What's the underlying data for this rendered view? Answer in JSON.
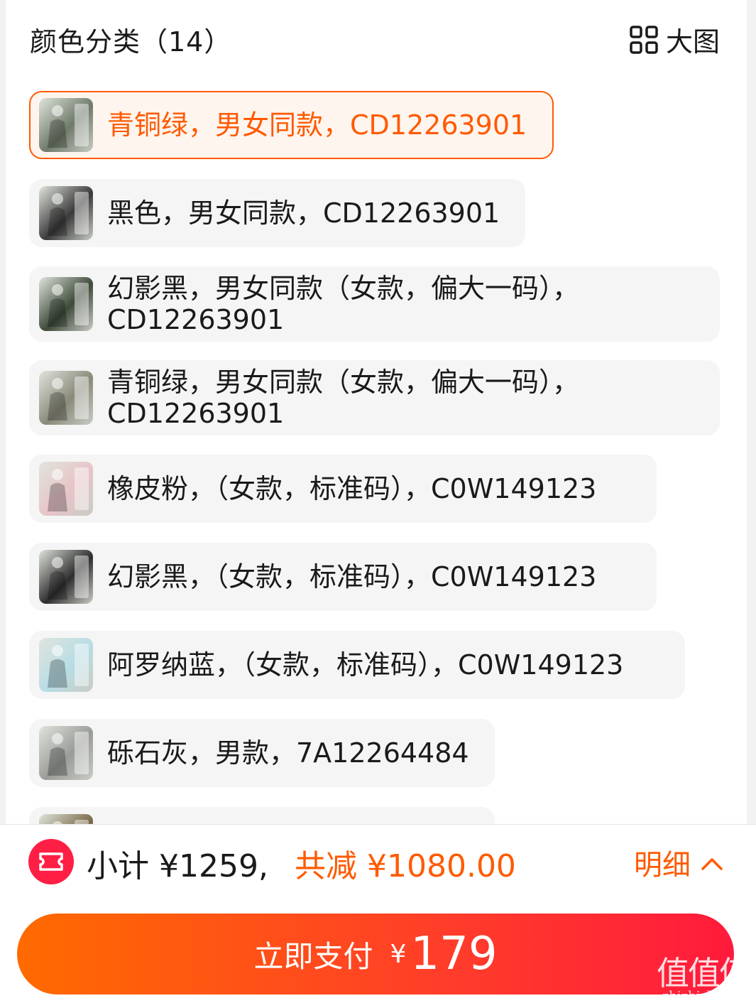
{
  "header": {
    "title": "颜色分类（14）",
    "big_image_label": "大图",
    "big_image_icon": "grid-icon"
  },
  "options": [
    {
      "label": "青铜绿，男女同款，CD12263901",
      "selected": true,
      "thumb_color": "#6f7a6a"
    },
    {
      "label": "黑色，男女同款，CD12263901",
      "selected": false,
      "thumb_color": "#3a3a3a"
    },
    {
      "label": "幻影黑，男女同款（女款，偏大一码），\nCD12263901",
      "selected": false,
      "thumb_color": "#3e4a3a"
    },
    {
      "label": "青铜绿，男女同款（女款，偏大一码），\nCD12263901",
      "selected": false,
      "thumb_color": "#8a8a7a"
    },
    {
      "label": "橡皮粉，（女款，标准码），C0W149123",
      "selected": false,
      "thumb_color": "#e8c4c8"
    },
    {
      "label": "幻影黑，（女款，标准码），C0W149123",
      "selected": false,
      "thumb_color": "#2e2e2e"
    },
    {
      "label": "阿罗纳蓝，（女款，标准码），C0W149123",
      "selected": false,
      "thumb_color": "#b8dde6"
    },
    {
      "label": "砾石灰，男款，7A12264484",
      "selected": false,
      "thumb_color": "#9a9c98"
    },
    {
      "label": "",
      "selected": false,
      "thumb_color": "#7a6a4a"
    }
  ],
  "footer": {
    "coupon_icon": "ticket-icon",
    "subtotal": "小计 ¥1259,",
    "reduce": "共减 ¥1080.00",
    "detail_label": "明细",
    "detail_icon": "chevron-up-icon",
    "pay_label": "立即支付",
    "pay_currency": "¥",
    "pay_amount": "179",
    "accent_color": "#ff5a00",
    "pay_gradient": [
      "#ff6a00",
      "#ff1a3c"
    ]
  },
  "watermark": {
    "line1": "值值值",
    "line2": "zhizhizhi.com"
  }
}
